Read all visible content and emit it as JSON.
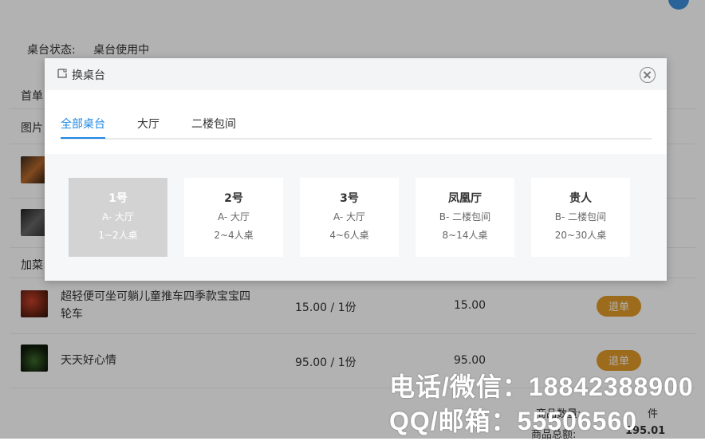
{
  "page": {
    "status_label": "桌台状态:",
    "status_value": "桌台使用中",
    "section_first": "首单",
    "section_image": "图片",
    "section_add": "加菜"
  },
  "items": [
    {
      "name": "超轻便可坐可躺儿童推车四季款宝宝四轮车",
      "price": "15.00 / 1份",
      "subtotal": "15.00",
      "action": "退单"
    },
    {
      "name": "天天好心情",
      "price": "95.00 / 1份",
      "subtotal": "95.00",
      "action": "退单"
    }
  ],
  "summary": {
    "count_label": "商品数量:",
    "count_suffix": "件",
    "total_label": "商品总额:",
    "total_value": "195.01"
  },
  "watermark": {
    "line1": "电话/微信：18842388900",
    "line2": "QQ/邮箱：55506560"
  },
  "modal": {
    "title": "换桌台",
    "tabs": [
      "全部桌台",
      "大厅",
      "二楼包间"
    ],
    "active_tab": "全部桌台",
    "tables": [
      {
        "number": "1号",
        "zone": "A- 大厅",
        "capacity": "1~2人桌",
        "selected": true
      },
      {
        "number": "2号",
        "zone": "A- 大厅",
        "capacity": "2~4人桌",
        "selected": false
      },
      {
        "number": "3号",
        "zone": "A- 大厅",
        "capacity": "4~6人桌",
        "selected": false
      },
      {
        "number": "凤凰厅",
        "zone": "B- 二楼包间",
        "capacity": "8~14人桌",
        "selected": false
      },
      {
        "number": "贵人",
        "zone": "B- 二楼包间",
        "capacity": "20~30人桌",
        "selected": false
      }
    ]
  },
  "colors": {
    "accent": "#1e88e5",
    "refund_button": "#e09a27",
    "selected_card": "#d3d3d3"
  }
}
